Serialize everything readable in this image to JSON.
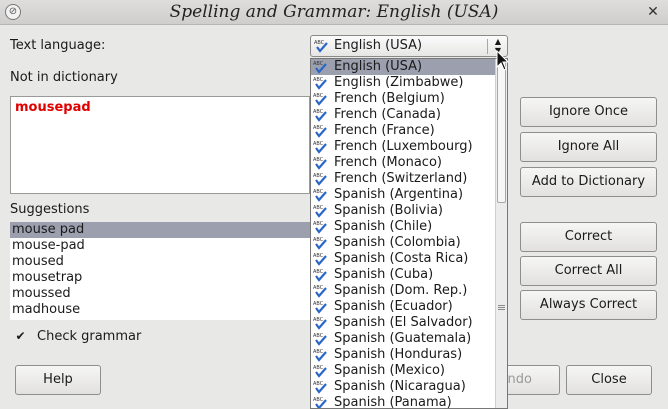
{
  "window": {
    "title": "Spelling and Grammar: English (USA)",
    "menu_icon": "window-menu-icon",
    "close_icon": "close-x-icon"
  },
  "text_language": {
    "label": "Text language:",
    "selected": "English (USA)"
  },
  "not_in_dictionary": {
    "label": "Not in dictionary",
    "word": "mousepad"
  },
  "suggestions": {
    "label": "Suggestions",
    "items": [
      "mouse pad",
      "mouse-pad",
      "moused",
      "mousetrap",
      "moussed",
      "madhouse"
    ],
    "selected_index": 0
  },
  "check_grammar": {
    "label": "Check grammar",
    "checked": true
  },
  "buttons": {
    "ignore_once": "Ignore Once",
    "ignore_all": "Ignore All",
    "add_to_dictionary": "Add to Dictionary",
    "correct": "Correct",
    "correct_all": "Correct All",
    "always_correct": "Always Correct",
    "help": "Help",
    "undo_partial": "ndo",
    "close": "Close"
  },
  "language_dropdown": {
    "selected_index": 0,
    "item_icon": "spellcheck-abc-icon",
    "items": [
      "English (USA)",
      "English (Zimbabwe)",
      "French (Belgium)",
      "French (Canada)",
      "French (France)",
      "French (Luxembourg)",
      "French (Monaco)",
      "French (Switzerland)",
      "Spanish (Argentina)",
      "Spanish (Bolivia)",
      "Spanish (Chile)",
      "Spanish (Colombia)",
      "Spanish (Costa Rica)",
      "Spanish (Cuba)",
      "Spanish (Dom. Rep.)",
      "Spanish (Ecuador)",
      "Spanish (El Salvador)",
      "Spanish (Guatemala)",
      "Spanish (Honduras)",
      "Spanish (Mexico)",
      "Spanish (Nicaragua)",
      "Spanish (Panama)"
    ]
  },
  "colors": {
    "misspelled_word": "#e00000",
    "selection": "#9ca0ae",
    "check_icon_blue": "#2a66c8"
  }
}
